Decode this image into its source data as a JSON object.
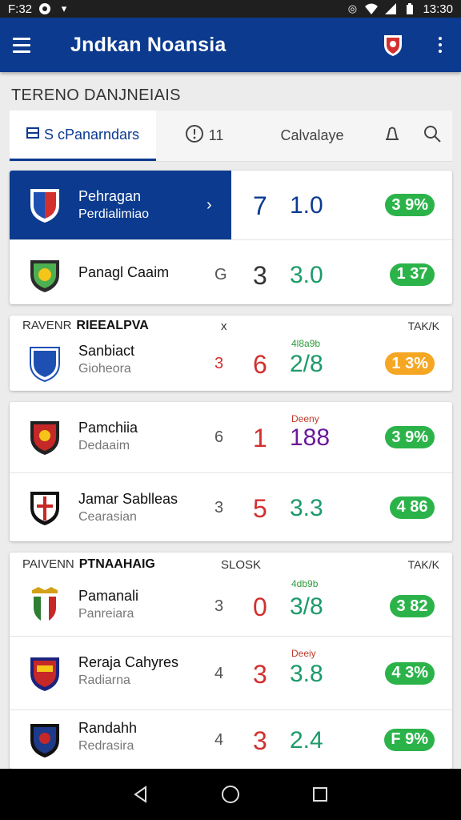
{
  "status": {
    "time": "F:32",
    "right_time": "13:30"
  },
  "app": {
    "title": "Jndkan Noansia"
  },
  "section_label": "TERENO DANJNEIAIS",
  "tabs": [
    {
      "label": "S cPanarndars",
      "icon": "table-icon"
    },
    {
      "label": "11",
      "icon": "clock-icon"
    },
    {
      "label": "Calvalaye",
      "icon": ""
    },
    {
      "label": "",
      "icon": "bell-icon"
    },
    {
      "label": "",
      "icon": "search-icon"
    }
  ],
  "cards": [
    {
      "rows": [
        {
          "name": "Pehragan",
          "sub": "Perdialimiao",
          "big": "7",
          "score": "1.0",
          "pill": "3 9%",
          "highlight": true
        },
        {
          "name": "Panagl Caaim",
          "sub": "",
          "small": "G",
          "big": "3",
          "score": "3.0",
          "pill": "1 37"
        }
      ]
    },
    {
      "head": {
        "left": "RAVENR",
        "bold": "RIEEALPVA",
        "mid": "x",
        "right": "TAK/K"
      },
      "rows": [
        {
          "name": "Sanbiact",
          "sub": "Gioheora",
          "small": "3",
          "big": "6",
          "tag": "4l8a9b",
          "score": "2/8",
          "pill": "1 3%",
          "pill_orange": true
        }
      ]
    },
    {
      "rows": [
        {
          "name": "Pamchiia",
          "sub": "Dedaaim",
          "small": "6",
          "big": "1",
          "tag": "Deeny",
          "score": "188",
          "pill": "3 9%"
        },
        {
          "name": "Jamar Sablleas",
          "sub": "Cearasian",
          "small": "3",
          "big": "5",
          "score": "3.3",
          "pill": "4 86"
        }
      ]
    },
    {
      "head": {
        "left": "PAIVENN",
        "bold": "PTNAAHAIG",
        "mid": "SLOSK",
        "right": "TAK/K"
      },
      "rows": [
        {
          "name": "Pamanali",
          "sub": "Panreiara",
          "small": "3",
          "big": "0",
          "tag": "4db9b",
          "score": "3/8",
          "pill": "3 82"
        },
        {
          "name": "Reraja Cahyres",
          "sub": "Radiarna",
          "small": "4",
          "big": "3",
          "tag": "Deeiy",
          "score": "3.8",
          "pill": "4 3%"
        },
        {
          "name": "Randahh",
          "sub": "Redrasira",
          "small": "4",
          "big": "3",
          "score": "2.4",
          "pill": "F 9%"
        }
      ]
    }
  ]
}
